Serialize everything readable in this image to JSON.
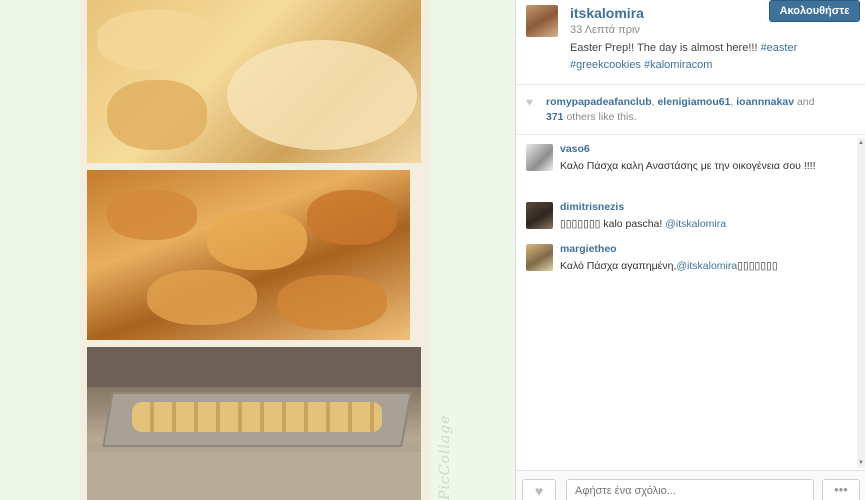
{
  "post": {
    "username": "itskalomira",
    "time": "33 Λεπτά πριν",
    "caption_text": "Easter Prep!! The day is almost here!!! ",
    "tags": [
      "#easter",
      "#greekcookies",
      "#kalomiracom"
    ],
    "follow_label": "Ακολουθήστε"
  },
  "image": {
    "watermark": "PicCollage",
    "tiles": [
      "pastries-on-plates",
      "braided-rolls",
      "cookies-on-baking-tray"
    ]
  },
  "likes": {
    "users": [
      "romypapadeafanclub",
      "elenigiamou61",
      "ioannnakav"
    ],
    "and_label": "and",
    "others_count": "371",
    "others_suffix": "others like this."
  },
  "comments": [
    {
      "user": "vaso6",
      "text": "Καλο Πάσχα καλη Αναστάσης με την οικογένεια σου !!!!",
      "mention": ""
    },
    {
      "user": "dimitrisnezis",
      "text": "▯▯▯▯▯▯▯ kalo pascha! ",
      "mention": "@itskalomira"
    },
    {
      "user": "margietheo",
      "text": "Καλό Πάσχα αγαπημένη,",
      "mention": "@itskalomira",
      "suffix": "▯▯▯▯▯▯▯"
    }
  ],
  "footer": {
    "comment_placeholder": "Αφήστε ένα σχόλιο...",
    "more_label": "•••",
    "like_icon": "heart-icon"
  },
  "colors": {
    "accent": "#3f729b",
    "muted": "#8a8a8a"
  }
}
